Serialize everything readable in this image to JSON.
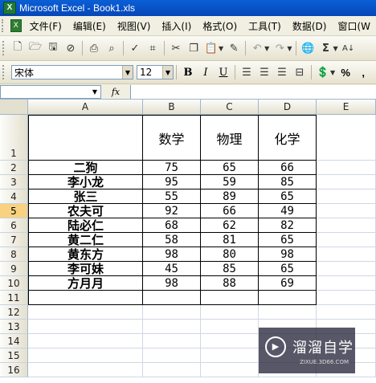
{
  "window": {
    "title": "Microsoft Excel - Book1.xls"
  },
  "menubar": {
    "items": [
      "文件(F)",
      "编辑(E)",
      "视图(V)",
      "插入(I)",
      "格式(O)",
      "工具(T)",
      "数据(D)",
      "窗口(W"
    ]
  },
  "toolbar2": {
    "font_name": "宋体",
    "font_size": "12",
    "bold": "B",
    "italic": "I",
    "underline": "U",
    "percent": "%"
  },
  "formula_bar": {
    "fx": "fx",
    "name_box": "",
    "formula": ""
  },
  "grid": {
    "columns": [
      "A",
      "B",
      "C",
      "D",
      "E"
    ],
    "rows": [
      "1",
      "2",
      "3",
      "4",
      "5",
      "6",
      "7",
      "8",
      "9",
      "10",
      "11",
      "12",
      "13",
      "14",
      "15",
      "16"
    ],
    "active_row": "5",
    "headers": [
      "数学",
      "物理",
      "化学"
    ],
    "data": [
      {
        "name": "二狗",
        "math": "75",
        "physics": "65",
        "chemistry": "66"
      },
      {
        "name": "李小龙",
        "math": "95",
        "physics": "59",
        "chemistry": "85"
      },
      {
        "name": "张三",
        "math": "55",
        "physics": "89",
        "chemistry": "65"
      },
      {
        "name": "农夫可",
        "math": "92",
        "physics": "66",
        "chemistry": "49"
      },
      {
        "name": "陆必仁",
        "math": "68",
        "physics": "62",
        "chemistry": "82"
      },
      {
        "name": "黄二仁",
        "math": "58",
        "physics": "81",
        "chemistry": "65"
      },
      {
        "name": "黄东方",
        "math": "98",
        "physics": "80",
        "chemistry": "98"
      },
      {
        "name": "李可妹",
        "math": "45",
        "physics": "85",
        "chemistry": "65"
      },
      {
        "name": "方月月",
        "math": "98",
        "physics": "88",
        "chemistry": "69"
      }
    ]
  },
  "watermark": {
    "name": "溜溜自学",
    "sub": "ZIXUE.3D66.COM"
  }
}
